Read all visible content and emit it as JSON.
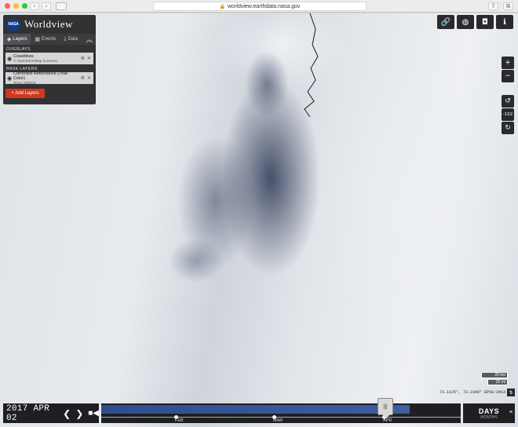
{
  "browser": {
    "url": "worldview.earthdata.nasa.gov",
    "traffic_lights": [
      "#ff5f57",
      "#febc2e",
      "#28c840"
    ]
  },
  "app": {
    "logo_text": "NASA",
    "title": "Worldview"
  },
  "tabs": [
    {
      "label": "Layers",
      "icon": "layers-icon",
      "active": true
    },
    {
      "label": "Events",
      "icon": "calendar-icon",
      "active": false
    },
    {
      "label": "Data",
      "icon": "download-icon",
      "active": false
    }
  ],
  "overlays": {
    "heading": "OVERLAYS",
    "items": [
      {
        "name": "Coastlines",
        "subtitle": "© OpenStreetMap (License)"
      }
    ]
  },
  "base_layers": {
    "heading": "BASE LAYERS",
    "items": [
      {
        "name": "Corrected Reflectance (True Color)",
        "subtitle": "Terra / MODIS"
      }
    ]
  },
  "add_layers_label": "+ Add Layers",
  "top_tools": [
    "link-icon",
    "globe-icon",
    "camera-icon",
    "info-icon"
  ],
  "zoom": {
    "in": "+",
    "out": "−"
  },
  "rotation": {
    "ccw": "↺",
    "value": "-102",
    "cw": "↻"
  },
  "scale": {
    "km": "20 km",
    "mi": "20 mi"
  },
  "coordinates": "73.1125°, 73.2340° EPSG:3413",
  "timeline": {
    "date": "2017 APR 02",
    "months": [
      {
        "label": "FEB"
      },
      {
        "label": "MAR"
      },
      {
        "label": "APR"
      }
    ],
    "zoom_level": "DAYS",
    "zoom_sub": "MONTHS",
    "accent": "#3d5ea3"
  }
}
